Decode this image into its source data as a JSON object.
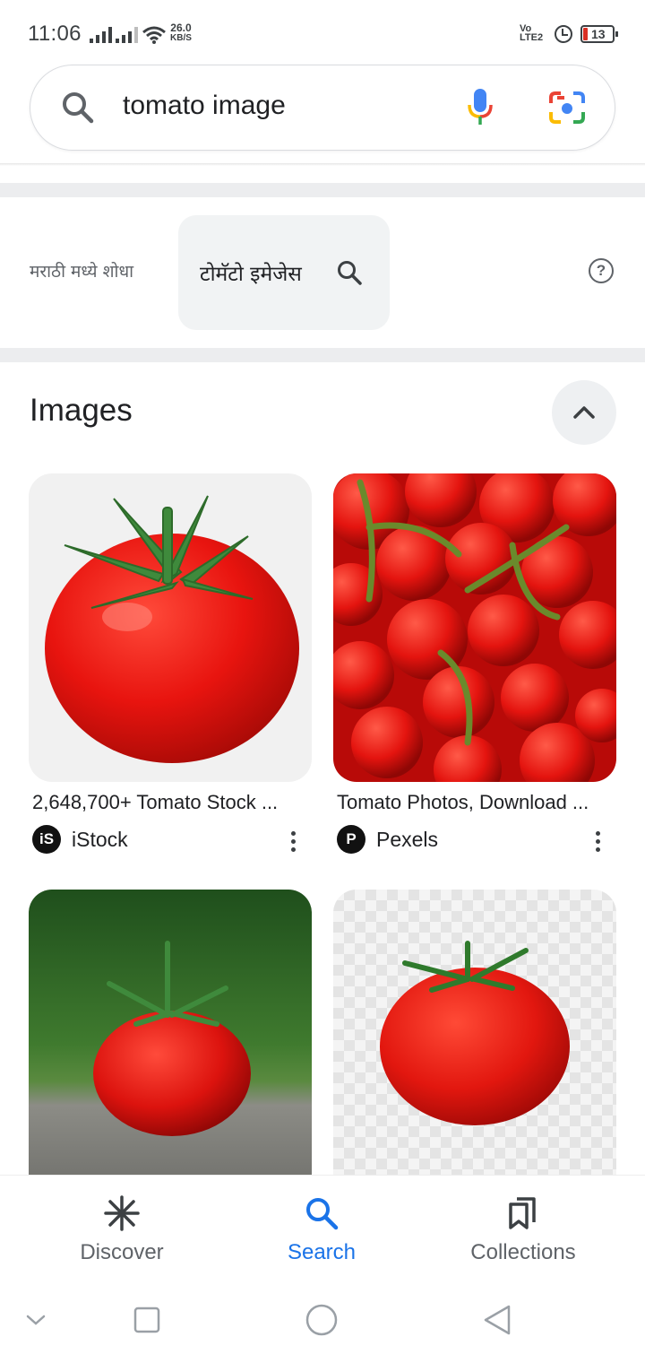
{
  "status_bar": {
    "time": "11:06",
    "net_speed_value": "26.0",
    "net_speed_unit": "KB/S",
    "volte_top": "Vo",
    "volte_bottom": "LTE2",
    "battery": "13",
    "battery_color": "#d93025"
  },
  "search": {
    "query": "tomato image",
    "icons": [
      "search-icon",
      "mic-icon",
      "lens-icon"
    ]
  },
  "translate_suggestion": {
    "label": "मराठी मध्ये शोधा",
    "chip_text": "टोमॅटो इमेजेस",
    "help_symbol": "?"
  },
  "images_section": {
    "heading": "Images",
    "results": [
      {
        "title": "2,648,700+ Tomato Stock ...",
        "source": "iStock",
        "source_logo": "iS"
      },
      {
        "title": "Tomato Photos, Download ...",
        "source": "Pexels",
        "source_logo": "P"
      },
      {
        "title": "",
        "source": "",
        "source_logo": ""
      },
      {
        "title": "",
        "source": "",
        "source_logo": ""
      }
    ]
  },
  "bottom_nav": {
    "items": [
      {
        "label": "Discover",
        "icon": "discover-icon",
        "active": false
      },
      {
        "label": "Search",
        "icon": "search-icon",
        "active": true
      },
      {
        "label": "Collections",
        "icon": "collections-icon",
        "active": false
      }
    ],
    "active_color": "#1a73e8"
  },
  "system_nav": {
    "icons": [
      "chevron-down-icon",
      "recents-icon",
      "home-icon",
      "back-icon"
    ]
  }
}
